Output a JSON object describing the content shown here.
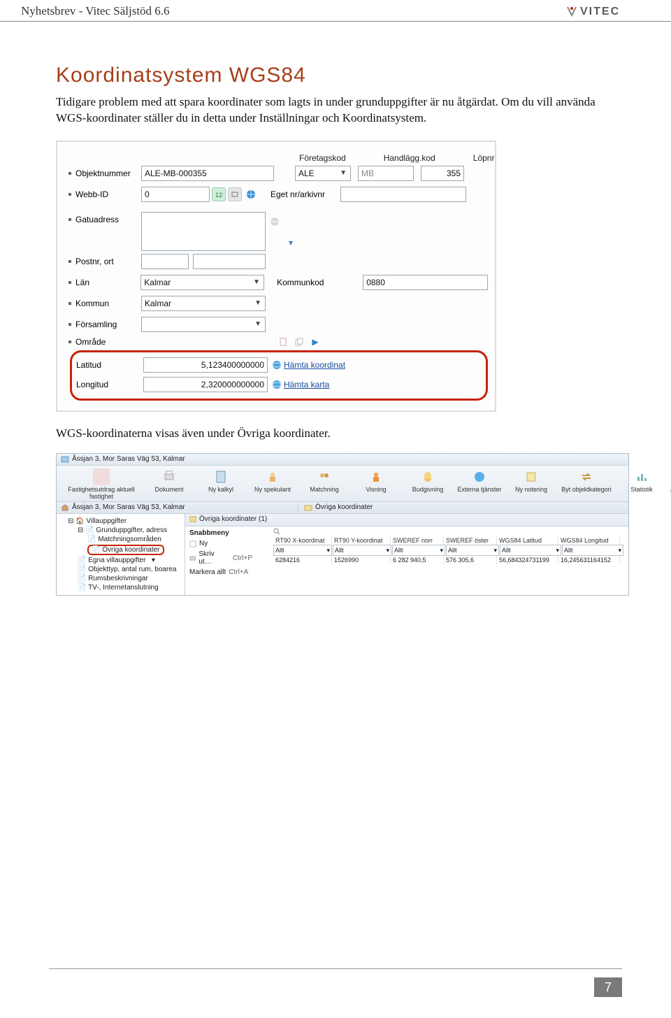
{
  "header": {
    "title": "Nyhetsbrev - Vitec Säljstöd 6.6",
    "brand": "VITEC"
  },
  "page": {
    "title": "Koordinatsystem WGS84",
    "para1": "Tidigare problem med att spara koordinater som lagts in under grunduppgifter är nu åtgärdat. Om du vill använda WGS-koordinater ställer du in detta under Inställningar och Koordinatsystem.",
    "para2": "WGS-koordinaterna visas även under Övriga koordinater.",
    "number": "7"
  },
  "form": {
    "labels": {
      "foretagskod": "Företagskod",
      "handlaggkod": "Handlägg.kod",
      "lopnr": "Löpnr",
      "objektnummer": "Objektnummer",
      "webbid": "Webb-ID",
      "egetnr": "Eget nr/arkivnr",
      "gatuadress": "Gatuadress",
      "postnrort": "Postnr, ort",
      "lan": "Län",
      "kommunkod": "Kommunkod",
      "kommun": "Kommun",
      "forsamling": "Församling",
      "omrade": "Område",
      "latitud": "Latitud",
      "longitud": "Longitud"
    },
    "values": {
      "objektnummer": "ALE-MB-000355",
      "foretagskod": "ALE",
      "handlaggkod": "MB",
      "lopnr": "355",
      "webbid": "0",
      "gatuadress": "",
      "postnr": "",
      "ort": "",
      "lan": "Kalmar",
      "kommunkod": "0880",
      "kommun": "Kalmar",
      "forsamling": "",
      "latitud": "5,123400000000",
      "longitud": "2,320000000000"
    },
    "links": {
      "hamtakoord": "Hämta koordinat",
      "hamtakarta": "Hämta karta"
    }
  },
  "app": {
    "title": "Åssjan 3, Mor Saras Väg 53, Kalmar",
    "ribbon": [
      "Fastighetsutdrag aktuell fastighet",
      "Dokument",
      "Ny kalkyl",
      "Ny spekulant",
      "Matchning",
      "Visning",
      "Budgivning",
      "Externa tjänster",
      "Ny notering",
      "Byt objektkategori",
      "Statistik",
      "Journal Mäklarlagen"
    ],
    "breadcrumb": "Åssjan 3, Mor Saras Väg 53, Kalmar",
    "pane_title": "Övriga koordinater",
    "pane_count": "Övriga koordinater (1)",
    "tree": [
      "Villauppgifter",
      "Grunduppgifter, adress",
      "Matchningsområden",
      "Övriga koordinater",
      "Egna villauppgifter",
      "Objekttyp, antal rum, boarea",
      "Rumsbeskrivningar",
      "TV-, Internetanslutning"
    ],
    "snabbmeny": {
      "title": "Snabbmeny",
      "ny": "Ny",
      "skrivut": "Skriv ut…",
      "skrivut_sc": "Ctrl+P",
      "markera": "Markera allt",
      "markera_sc": "Ctrl+A"
    },
    "grid": {
      "cols": [
        "RT90 X-koordinat",
        "RT90 Y-koordinat",
        "SWEREF norr",
        "SWEREF öster",
        "WGS84 Latitud",
        "WGS84 Longitud"
      ],
      "filter": "Allt",
      "row": [
        "6284216",
        "1526990",
        "6 282 940,5",
        "576 305,6",
        "56,684324731199",
        "16,245631164152"
      ]
    }
  }
}
